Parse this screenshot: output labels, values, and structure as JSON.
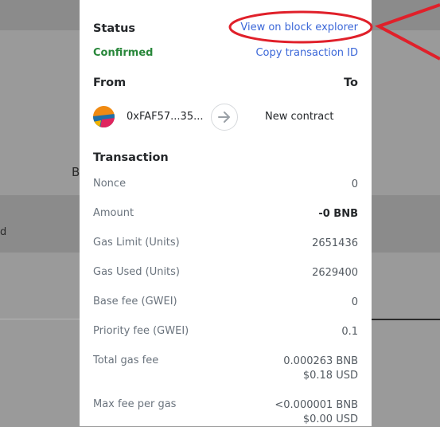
{
  "status": {
    "heading": "Status",
    "state": "Confirmed",
    "view_explorer": "View on block explorer",
    "copy_tx": "Copy transaction ID"
  },
  "parties": {
    "from_label": "From",
    "to_label": "To",
    "from_address": "0xFAF57...35...",
    "to_address": "New contract"
  },
  "transaction": {
    "heading": "Transaction",
    "rows": [
      {
        "label": "Nonce",
        "value": "0"
      },
      {
        "label": "Amount",
        "value": "-0 BNB"
      },
      {
        "label": "Gas Limit (Units)",
        "value": "2651436"
      },
      {
        "label": "Gas Used (Units)",
        "value": "2629400"
      },
      {
        "label": "Base fee (GWEI)",
        "value": "0"
      },
      {
        "label": "Priority fee (GWEI)",
        "value": "0.1"
      },
      {
        "label": "Total gas fee",
        "value": "0.000263 BNB",
        "value2": "$0.18 USD"
      },
      {
        "label": "Max fee per gas",
        "value": "<0.000001 BNB",
        "value2": "$0.00 USD"
      }
    ]
  },
  "background": {
    "text_b": "B",
    "text_d": "d"
  },
  "colors": {
    "link": "#3b67d8",
    "confirmed": "#28873a",
    "annotation": "#e0202a"
  }
}
